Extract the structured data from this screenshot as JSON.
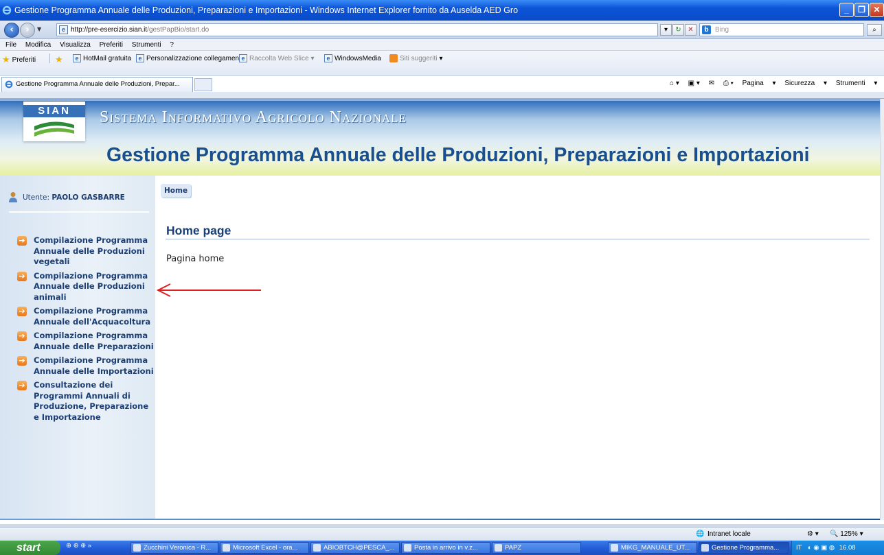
{
  "window": {
    "title": "Gestione Programma Annuale delle Produzioni, Preparazioni e Importazioni - Windows Internet Explorer fornito da Auselda AED Gro"
  },
  "address": {
    "host": "http://pre-esercizio.sian.it",
    "path": "/gestPapBio/start.do"
  },
  "search": {
    "placeholder": "Bing"
  },
  "menubar": [
    "File",
    "Modifica",
    "Visualizza",
    "Preferiti",
    "Strumenti",
    "?"
  ],
  "favorites": {
    "label": "Preferiti",
    "items": [
      "HotMail gratuita",
      "Personalizzazione collegamenti",
      "Raccolta Web Slice",
      "WindowsMedia",
      "Siti suggeriti"
    ]
  },
  "tab": {
    "title": "Gestione Programma Annuale delle Produzioni, Prepar..."
  },
  "tools": [
    "Pagina",
    "Sicurezza",
    "Strumenti"
  ],
  "banner": {
    "logo_text": "SIAN",
    "system_name": "Sistema Informativo Agricolo Nazionale",
    "app_title": "Gestione Programma Annuale delle Produzioni, Preparazioni e Importazioni"
  },
  "user": {
    "label": "Utente:",
    "name": "PAOLO GASBARRE"
  },
  "sidebar": {
    "items": [
      {
        "label": "Compilazione Programma Annuale delle Produzioni vegetali"
      },
      {
        "label": "Compilazione Programma Annuale delle Produzioni animali"
      },
      {
        "label": "Compilazione Programma Annuale dell'Acquacoltura"
      },
      {
        "label": "Compilazione Programma Annuale delle Preparazioni"
      },
      {
        "label": "Compilazione Programma Annuale delle Importazioni"
      },
      {
        "label": "Consultazione dei Programmi Annuali di Produzione, Preparazione e Importazione"
      }
    ]
  },
  "main": {
    "breadcrumb": "Home",
    "page_title": "Home page",
    "content": "Pagina home"
  },
  "status": {
    "zone": "Intranet locale",
    "zoom": "125%"
  },
  "taskbar": {
    "start": "start",
    "tasks": [
      "Zucchini Veronica - R...",
      "Microsoft Excel - ora...",
      "ABIOBTCH@PESCA_...",
      "Posta in arrivo in v.z...",
      "PAPZ",
      "MIKG_MANUALE_UT...",
      "Gestione Programma..."
    ],
    "lang": "IT",
    "clock": "16.08"
  },
  "colors": {
    "accent": "#1a4f8f",
    "menu_text": "#1c3e73",
    "annotation_arrow": "#e02020"
  }
}
